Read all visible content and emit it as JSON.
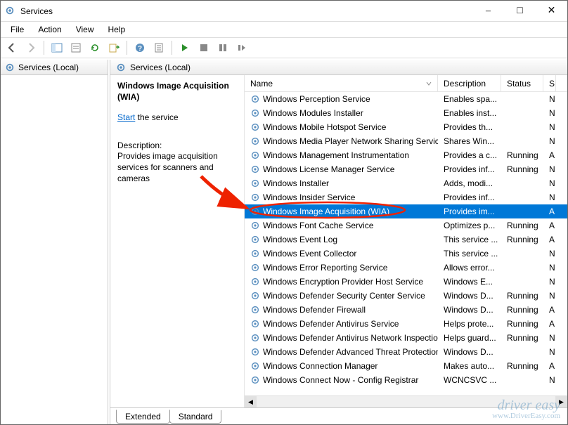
{
  "window": {
    "title": "Services"
  },
  "menu": {
    "file": "File",
    "action": "Action",
    "view": "View",
    "help": "Help"
  },
  "tree": {
    "root": "Services (Local)"
  },
  "header": {
    "title": "Services (Local)"
  },
  "detail": {
    "service_name": "Windows Image Acquisition (WIA)",
    "start_link": "Start",
    "start_suffix": " the service",
    "desc_label": "Description:",
    "desc_text": "Provides image acquisition services for scanners and cameras"
  },
  "columns": {
    "name": "Name",
    "description": "Description",
    "status": "Status",
    "s": "S"
  },
  "tabs": {
    "extended": "Extended",
    "standard": "Standard"
  },
  "watermark": {
    "brand": "driver easy",
    "url": "www.DriverEasy.com"
  },
  "services": [
    {
      "name": "Windows Perception Service",
      "desc": "Enables spa...",
      "status": "",
      "s": "N"
    },
    {
      "name": "Windows Modules Installer",
      "desc": "Enables inst...",
      "status": "",
      "s": "N"
    },
    {
      "name": "Windows Mobile Hotspot Service",
      "desc": "Provides th...",
      "status": "",
      "s": "N"
    },
    {
      "name": "Windows Media Player Network Sharing Service",
      "desc": "Shares Win...",
      "status": "",
      "s": "N"
    },
    {
      "name": "Windows Management Instrumentation",
      "desc": "Provides a c...",
      "status": "Running",
      "s": "A"
    },
    {
      "name": "Windows License Manager Service",
      "desc": "Provides inf...",
      "status": "Running",
      "s": "N"
    },
    {
      "name": "Windows Installer",
      "desc": "Adds, modi...",
      "status": "",
      "s": "N"
    },
    {
      "name": "Windows Insider Service",
      "desc": "Provides inf...",
      "status": "",
      "s": "N"
    },
    {
      "name": "Windows Image Acquisition (WIA)",
      "desc": "Provides im...",
      "status": "",
      "s": "A",
      "selected": true
    },
    {
      "name": "Windows Font Cache Service",
      "desc": "Optimizes p...",
      "status": "Running",
      "s": "A"
    },
    {
      "name": "Windows Event Log",
      "desc": "This service ...",
      "status": "Running",
      "s": "A"
    },
    {
      "name": "Windows Event Collector",
      "desc": "This service ...",
      "status": "",
      "s": "N"
    },
    {
      "name": "Windows Error Reporting Service",
      "desc": "Allows error...",
      "status": "",
      "s": "N"
    },
    {
      "name": "Windows Encryption Provider Host Service",
      "desc": "Windows E...",
      "status": "",
      "s": "N"
    },
    {
      "name": "Windows Defender Security Center Service",
      "desc": "Windows D...",
      "status": "Running",
      "s": "N"
    },
    {
      "name": "Windows Defender Firewall",
      "desc": "Windows D...",
      "status": "Running",
      "s": "A"
    },
    {
      "name": "Windows Defender Antivirus Service",
      "desc": "Helps prote...",
      "status": "Running",
      "s": "A"
    },
    {
      "name": "Windows Defender Antivirus Network Inspectio...",
      "desc": "Helps guard...",
      "status": "Running",
      "s": "N"
    },
    {
      "name": "Windows Defender Advanced Threat Protection ...",
      "desc": "Windows D...",
      "status": "",
      "s": "N"
    },
    {
      "name": "Windows Connection Manager",
      "desc": "Makes auto...",
      "status": "Running",
      "s": "A"
    },
    {
      "name": "Windows Connect Now - Config Registrar",
      "desc": "WCNCSVC ...",
      "status": "",
      "s": "N"
    }
  ]
}
